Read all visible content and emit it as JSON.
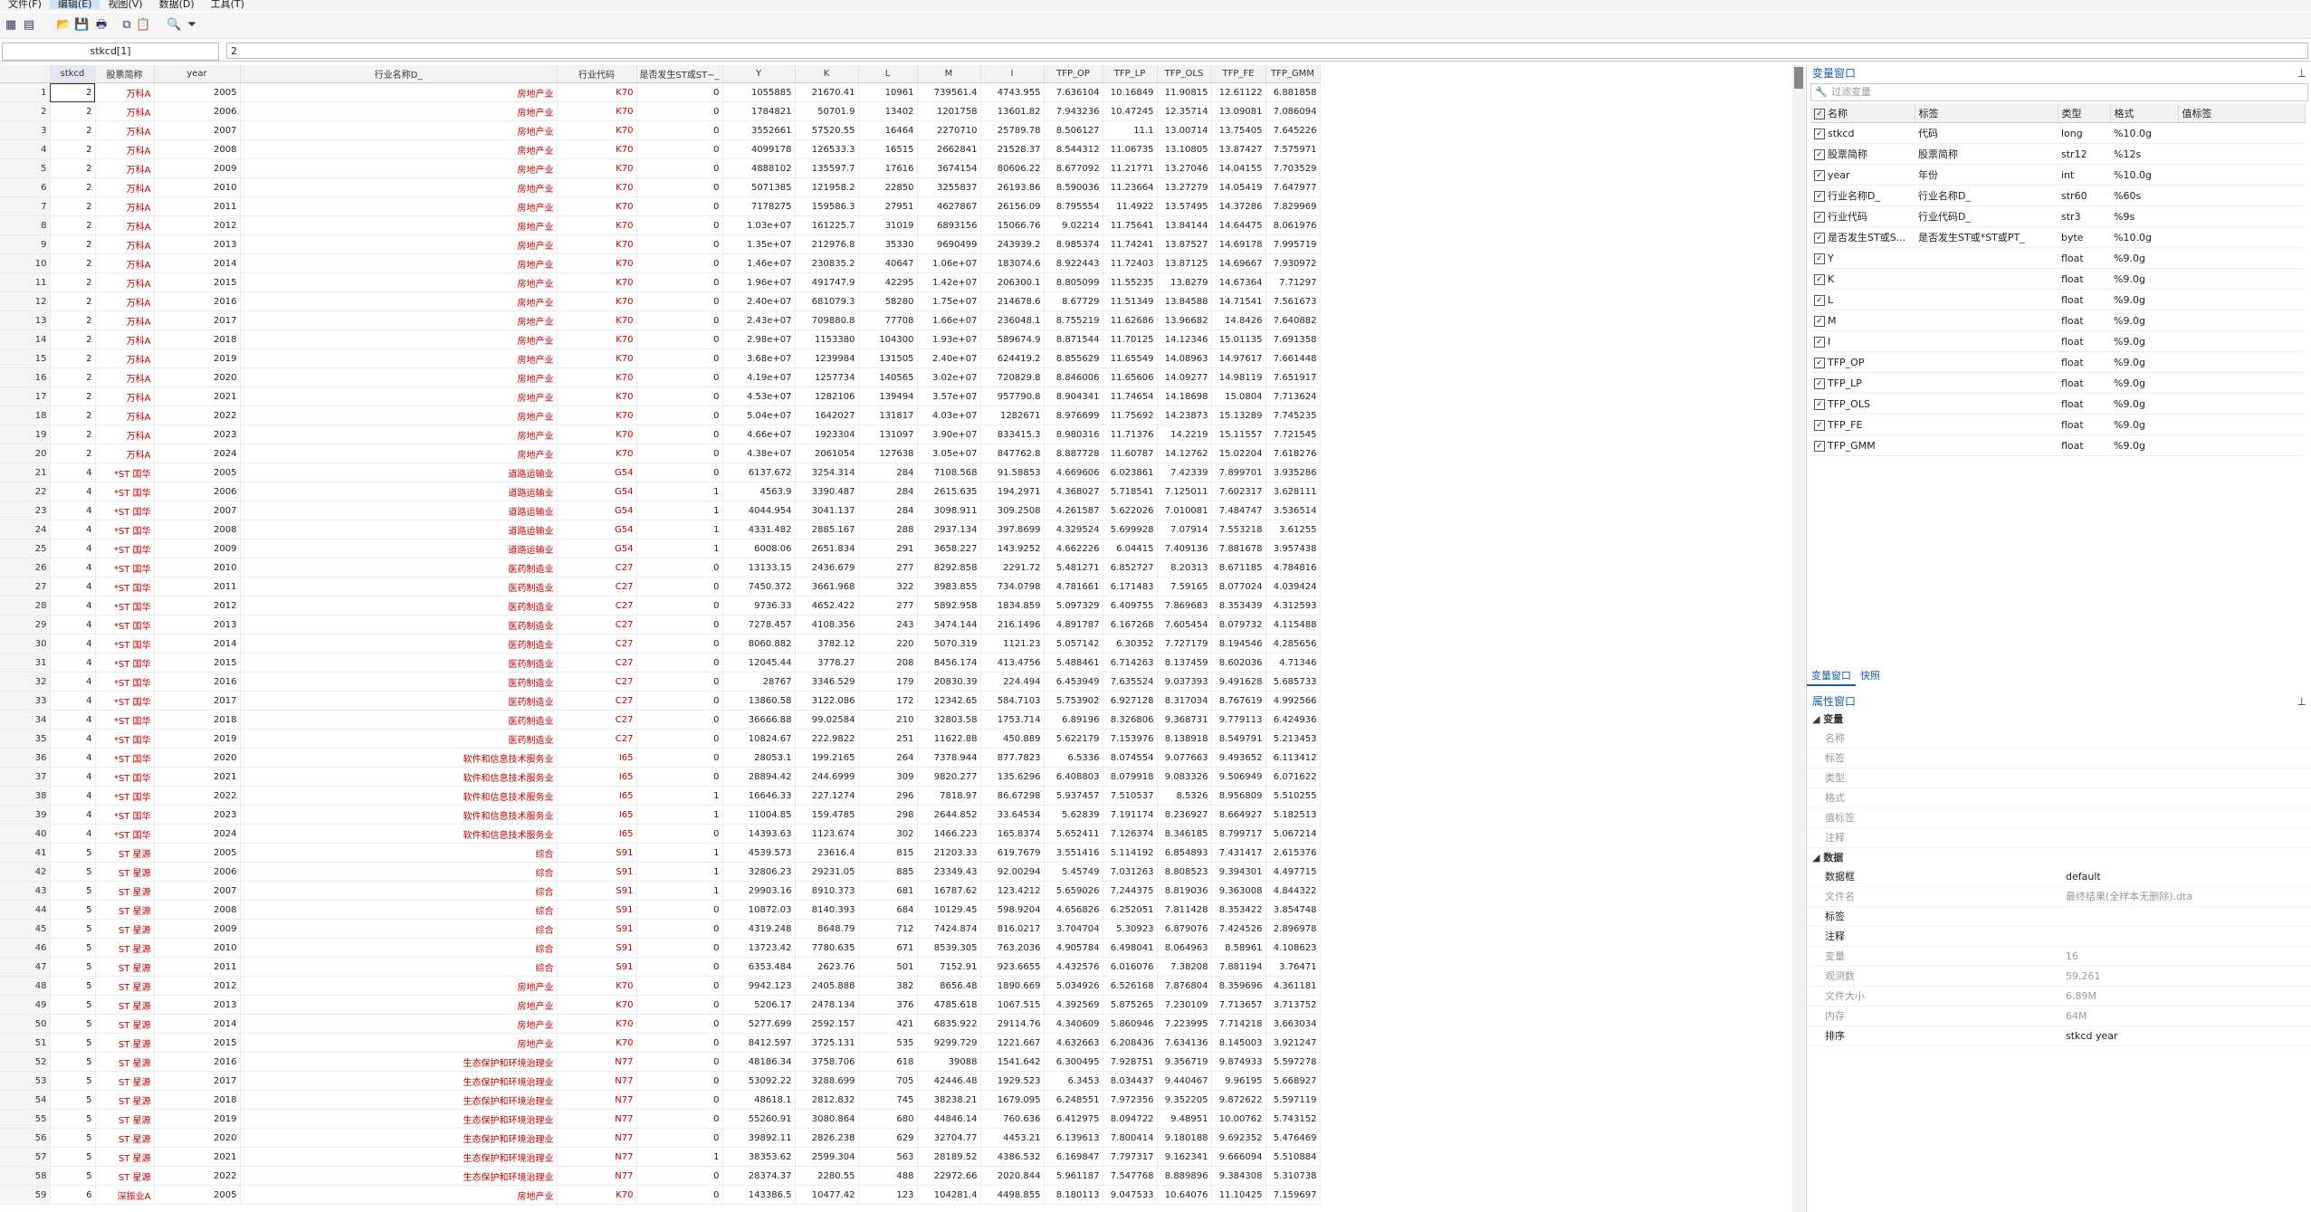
{
  "menu": [
    "文件(F)",
    "编辑(E)",
    "视图(V)",
    "数据(D)",
    "工具(T)"
  ],
  "toolbar_icons": [
    "browse-icon",
    "editor-icon",
    "open-icon",
    "save-icon",
    "print-icon",
    "copy-icon",
    "paste-icon",
    "find-icon",
    "filter-icon"
  ],
  "edit_bar": {
    "varname": "stkcd[1]",
    "value": "2"
  },
  "columns": [
    "stkcd",
    "股票简称",
    "year",
    "行业名称D_",
    "行业代码",
    "是否发生ST或ST~_",
    "Y",
    "K",
    "L",
    "M",
    "I",
    "TFP_OP",
    "TFP_LP",
    "TFP_OLS",
    "TFP_FE",
    "TFP_GMM"
  ],
  "rows": [
    [
      "2",
      "万科A",
      "2005",
      "房地产业",
      "K70",
      "0",
      "1055885",
      "21670.41",
      "10961",
      "739561.4",
      "4743.955",
      "7.636104",
      "10.16849",
      "11.90815",
      "12.61122",
      "6.881858"
    ],
    [
      "2",
      "万科A",
      "2006",
      "房地产业",
      "K70",
      "0",
      "1784821",
      "50701.9",
      "13402",
      "1201758",
      "13601.82",
      "7.943236",
      "10.47245",
      "12.35714",
      "13.09081",
      "7.086094"
    ],
    [
      "2",
      "万科A",
      "2007",
      "房地产业",
      "K70",
      "0",
      "3552661",
      "57520.55",
      "16464",
      "2270710",
      "25789.78",
      "8.506127",
      "11.1",
      "13.00714",
      "13.75405",
      "7.645226"
    ],
    [
      "2",
      "万科A",
      "2008",
      "房地产业",
      "K70",
      "0",
      "4099178",
      "126533.3",
      "16515",
      "2662841",
      "21528.37",
      "8.544312",
      "11.06735",
      "13.10805",
      "13.87427",
      "7.575971"
    ],
    [
      "2",
      "万科A",
      "2009",
      "房地产业",
      "K70",
      "0",
      "4888102",
      "135597.7",
      "17616",
      "3674154",
      "80606.22",
      "8.677092",
      "11.21771",
      "13.27046",
      "14.04155",
      "7.703529"
    ],
    [
      "2",
      "万科A",
      "2010",
      "房地产业",
      "K70",
      "0",
      "5071385",
      "121958.2",
      "22850",
      "3255837",
      "26193.86",
      "8.590036",
      "11.23664",
      "13.27279",
      "14.05419",
      "7.647977"
    ],
    [
      "2",
      "万科A",
      "2011",
      "房地产业",
      "K70",
      "0",
      "7178275",
      "159586.3",
      "27951",
      "4627867",
      "26156.09",
      "8.795554",
      "11.4922",
      "13.57495",
      "14.37286",
      "7.829969"
    ],
    [
      "2",
      "万科A",
      "2012",
      "房地产业",
      "K70",
      "0",
      "1.03e+07",
      "161225.7",
      "31019",
      "6893156",
      "15066.76",
      "9.02214",
      "11.75641",
      "13.84144",
      "14.64475",
      "8.061976"
    ],
    [
      "2",
      "万科A",
      "2013",
      "房地产业",
      "K70",
      "0",
      "1.35e+07",
      "212976.8",
      "35330",
      "9690499",
      "243939.2",
      "8.985374",
      "11.74241",
      "13.87527",
      "14.69178",
      "7.995719"
    ],
    [
      "2",
      "万科A",
      "2014",
      "房地产业",
      "K70",
      "0",
      "1.46e+07",
      "230835.2",
      "40647",
      "1.06e+07",
      "183074.6",
      "8.922443",
      "11.72403",
      "13.87125",
      "14.69667",
      "7.930972"
    ],
    [
      "2",
      "万科A",
      "2015",
      "房地产业",
      "K70",
      "0",
      "1.96e+07",
      "491747.9",
      "42295",
      "1.42e+07",
      "206300.1",
      "8.805099",
      "11.55235",
      "13.8279",
      "14.67364",
      "7.71297"
    ],
    [
      "2",
      "万科A",
      "2016",
      "房地产业",
      "K70",
      "0",
      "2.40e+07",
      "681079.3",
      "58280",
      "1.75e+07",
      "214678.6",
      "8.67729",
      "11.51349",
      "13.84588",
      "14.71541",
      "7.561673"
    ],
    [
      "2",
      "万科A",
      "2017",
      "房地产业",
      "K70",
      "0",
      "2.43e+07",
      "709880.8",
      "77708",
      "1.66e+07",
      "236048.1",
      "8.755219",
      "11.62686",
      "13.96682",
      "14.8426",
      "7.640882"
    ],
    [
      "2",
      "万科A",
      "2018",
      "房地产业",
      "K70",
      "0",
      "2.98e+07",
      "1153380",
      "104300",
      "1.93e+07",
      "589674.9",
      "8.871544",
      "11.70125",
      "14.12346",
      "15.01135",
      "7.691358"
    ],
    [
      "2",
      "万科A",
      "2019",
      "房地产业",
      "K70",
      "0",
      "3.68e+07",
      "1239984",
      "131505",
      "2.40e+07",
      "624419.2",
      "8.855629",
      "11.65549",
      "14.08963",
      "14.97617",
      "7.661448"
    ],
    [
      "2",
      "万科A",
      "2020",
      "房地产业",
      "K70",
      "0",
      "4.19e+07",
      "1257734",
      "140565",
      "3.02e+07",
      "720829.8",
      "8.846006",
      "11.65606",
      "14.09277",
      "14.98119",
      "7.651917"
    ],
    [
      "2",
      "万科A",
      "2021",
      "房地产业",
      "K70",
      "0",
      "4.53e+07",
      "1282106",
      "139494",
      "3.57e+07",
      "957790.8",
      "8.904341",
      "11.74654",
      "14.18698",
      "15.0804",
      "7.713624"
    ],
    [
      "2",
      "万科A",
      "2022",
      "房地产业",
      "K70",
      "0",
      "5.04e+07",
      "1642027",
      "131817",
      "4.03e+07",
      "1282671",
      "8.976699",
      "11.75692",
      "14.23873",
      "15.13289",
      "7.745235"
    ],
    [
      "2",
      "万科A",
      "2023",
      "房地产业",
      "K70",
      "0",
      "4.66e+07",
      "1923304",
      "131097",
      "3.90e+07",
      "833415.3",
      "8.980316",
      "11.71376",
      "14.2219",
      "15.11557",
      "7.721545"
    ],
    [
      "2",
      "万科A",
      "2024",
      "房地产业",
      "K70",
      "0",
      "4.38e+07",
      "2061054",
      "127638",
      "3.05e+07",
      "847762.8",
      "8.887728",
      "11.60787",
      "14.12762",
      "15.02204",
      "7.618276"
    ],
    [
      "4",
      "*ST 国华",
      "2005",
      "道路运输业",
      "G54",
      "0",
      "6137.672",
      "3254.314",
      "284",
      "7108.568",
      "91.58853",
      "4.669606",
      "6.023861",
      "7.42339",
      "7.899701",
      "3.935286"
    ],
    [
      "4",
      "*ST 国华",
      "2006",
      "道路运输业",
      "G54",
      "1",
      "4563.9",
      "3390.487",
      "284",
      "2615.635",
      "194.2971",
      "4.368027",
      "5.718541",
      "7.125011",
      "7.602317",
      "3.628111"
    ],
    [
      "4",
      "*ST 国华",
      "2007",
      "道路运输业",
      "G54",
      "1",
      "4044.954",
      "3041.137",
      "284",
      "3098.911",
      "309.2508",
      "4.261587",
      "5.622026",
      "7.010081",
      "7.484747",
      "3.536514"
    ],
    [
      "4",
      "*ST 国华",
      "2008",
      "道路运输业",
      "G54",
      "1",
      "4331.482",
      "2885.167",
      "288",
      "2937.134",
      "397.8699",
      "4.329524",
      "5.699928",
      "7.07914",
      "7.553218",
      "3.61255"
    ],
    [
      "4",
      "*ST 国华",
      "2009",
      "道路运输业",
      "G54",
      "1",
      "6008.06",
      "2651.834",
      "291",
      "3658.227",
      "143.9252",
      "4.662226",
      "6.04415",
      "7.409136",
      "7.881678",
      "3.957438"
    ],
    [
      "4",
      "*ST 国华",
      "2010",
      "医药制造业",
      "C27",
      "0",
      "13133.15",
      "2436.679",
      "277",
      "8292.858",
      "2291.72",
      "5.481271",
      "6.852727",
      "8.20313",
      "8.671185",
      "4.784816"
    ],
    [
      "4",
      "*ST 国华",
      "2011",
      "医药制造业",
      "C27",
      "0",
      "7450.372",
      "3661.968",
      "322",
      "3983.855",
      "734.0798",
      "4.781661",
      "6.171483",
      "7.59165",
      "8.077024",
      "4.039424"
    ],
    [
      "4",
      "*ST 国华",
      "2012",
      "医药制造业",
      "C27",
      "0",
      "9736.33",
      "4652.422",
      "277",
      "5892.958",
      "1834.859",
      "5.097329",
      "6.409755",
      "7.869683",
      "8.353439",
      "4.312593"
    ],
    [
      "4",
      "*ST 国华",
      "2013",
      "医药制造业",
      "C27",
      "0",
      "7278.457",
      "4108.356",
      "243",
      "3474.144",
      "216.1496",
      "4.891787",
      "6.167268",
      "7.605454",
      "8.079732",
      "4.115488"
    ],
    [
      "4",
      "*ST 国华",
      "2014",
      "医药制造业",
      "C27",
      "0",
      "8060.882",
      "3782.12",
      "220",
      "5070.319",
      "1121.23",
      "5.057142",
      "6.30352",
      "7.727179",
      "8.194546",
      "4.285656"
    ],
    [
      "4",
      "*ST 国华",
      "2015",
      "医药制造业",
      "C27",
      "0",
      "12045.44",
      "3778.27",
      "208",
      "8456.174",
      "413.4756",
      "5.488461",
      "6.714263",
      "8.137459",
      "8.602036",
      "4.71346"
    ],
    [
      "4",
      "*ST 国华",
      "2016",
      "医药制造业",
      "C27",
      "0",
      "28767",
      "3346.529",
      "179",
      "20830.39",
      "224.494",
      "6.453949",
      "7.635524",
      "9.037393",
      "9.491628",
      "5.685733"
    ],
    [
      "4",
      "*ST 国华",
      "2017",
      "医药制造业",
      "C27",
      "0",
      "13860.58",
      "3122.086",
      "172",
      "12342.65",
      "584.7103",
      "5.753902",
      "6.927128",
      "8.317034",
      "8.767619",
      "4.992566"
    ],
    [
      "4",
      "*ST 国华",
      "2018",
      "医药制造业",
      "C27",
      "0",
      "36666.88",
      "99.02584",
      "210",
      "32803.58",
      "1753.714",
      "6.89196",
      "8.326806",
      "9.368731",
      "9.779113",
      "6.424936"
    ],
    [
      "4",
      "*ST 国华",
      "2019",
      "医药制造业",
      "C27",
      "0",
      "10824.67",
      "222.9822",
      "251",
      "11622.88",
      "450.889",
      "5.622179",
      "7.153976",
      "8.138918",
      "8.549791",
      "5.213453"
    ],
    [
      "4",
      "*ST 国华",
      "2020",
      "软件和信息技术服务业",
      "I65",
      "0",
      "28053.1",
      "199.2165",
      "264",
      "7378.944",
      "877.7823",
      "6.5336",
      "8.074554",
      "9.077663",
      "9.493652",
      "6.113412"
    ],
    [
      "4",
      "*ST 国华",
      "2021",
      "软件和信息技术服务业",
      "I65",
      "0",
      "28894.42",
      "244.6999",
      "309",
      "9820.277",
      "135.6296",
      "6.408803",
      "8.079918",
      "9.083326",
      "9.506949",
      "6.071622"
    ],
    [
      "4",
      "*ST 国华",
      "2022",
      "软件和信息技术服务业",
      "I65",
      "1",
      "16646.33",
      "227.1274",
      "296",
      "7818.97",
      "86.67298",
      "5.937457",
      "7.510537",
      "8.5326",
      "8.956809",
      "5.510255"
    ],
    [
      "4",
      "*ST 国华",
      "2023",
      "软件和信息技术服务业",
      "I65",
      "1",
      "11004.85",
      "159.4785",
      "298",
      "2644.852",
      "33.64534",
      "5.62839",
      "7.191174",
      "8.236927",
      "8.664927",
      "5.182513"
    ],
    [
      "4",
      "*ST 国华",
      "2024",
      "软件和信息技术服务业",
      "I65",
      "0",
      "14393.63",
      "1123.674",
      "302",
      "1466.223",
      "165.8374",
      "5.652411",
      "7.126374",
      "8.346185",
      "8.799717",
      "5.067214"
    ],
    [
      "5",
      "ST 星源",
      "2005",
      "综合",
      "S91",
      "1",
      "4539.573",
      "23616.4",
      "815",
      "21203.33",
      "619.7679",
      "3.551416",
      "5.114192",
      "6.854893",
      "7.431417",
      "2.615376"
    ],
    [
      "5",
      "ST 星源",
      "2006",
      "综合",
      "S91",
      "1",
      "32806.23",
      "29231.05",
      "885",
      "23349.43",
      "92.00294",
      "5.45749",
      "7.031263",
      "8.808523",
      "9.394301",
      "4.497715"
    ],
    [
      "5",
      "ST 星源",
      "2007",
      "综合",
      "S91",
      "1",
      "29903.16",
      "8910.373",
      "681",
      "16787.62",
      "123.4212",
      "5.659026",
      "7.244375",
      "8.819036",
      "9.363008",
      "4.844322"
    ],
    [
      "5",
      "ST 星源",
      "2008",
      "综合",
      "S91",
      "0",
      "10872.03",
      "8140.393",
      "684",
      "10129.45",
      "598.9204",
      "4.656826",
      "6.252051",
      "7.811428",
      "8.353422",
      "3.854748"
    ],
    [
      "5",
      "ST 星源",
      "2009",
      "综合",
      "S91",
      "0",
      "4319.248",
      "8648.79",
      "712",
      "7424.874",
      "816.0217",
      "3.704704",
      "5.30923",
      "6.879076",
      "7.424526",
      "2.896978"
    ],
    [
      "5",
      "ST 星源",
      "2010",
      "综合",
      "S91",
      "0",
      "13723.42",
      "7780.635",
      "671",
      "8539.305",
      "763.2036",
      "4.905784",
      "6.498041",
      "8.064963",
      "8.58961",
      "4.108623"
    ],
    [
      "5",
      "ST 星源",
      "2011",
      "综合",
      "S91",
      "0",
      "6353.484",
      "2623.76",
      "501",
      "7152.91",
      "923.6655",
      "4.432576",
      "6.016076",
      "7.38208",
      "7.881194",
      "3.76471"
    ],
    [
      "5",
      "ST 星源",
      "2012",
      "房地产业",
      "K70",
      "0",
      "9942.123",
      "2405.888",
      "382",
      "8656.48",
      "1890.669",
      "5.034926",
      "6.526168",
      "7.876804",
      "8.359696",
      "4.361181"
    ],
    [
      "5",
      "ST 星源",
      "2013",
      "房地产业",
      "K70",
      "0",
      "5206.17",
      "2478.134",
      "376",
      "4785.618",
      "1067.515",
      "4.392569",
      "5.875265",
      "7.230109",
      "7.713657",
      "3.713752"
    ],
    [
      "5",
      "ST 星源",
      "2014",
      "房地产业",
      "K70",
      "0",
      "5277.699",
      "2592.157",
      "421",
      "6835.922",
      "29114.76",
      "4.340609",
      "5.860946",
      "7.223995",
      "7.714218",
      "3.663034"
    ],
    [
      "5",
      "ST 星源",
      "2015",
      "房地产业",
      "K70",
      "0",
      "8412.597",
      "3725.131",
      "535",
      "9299.729",
      "1221.667",
      "4.632663",
      "6.208436",
      "7.634136",
      "8.145003",
      "3.921247"
    ],
    [
      "5",
      "ST 星源",
      "2016",
      "生态保护和环境治理业",
      "N77",
      "0",
      "48186.34",
      "3758.706",
      "618",
      "39088",
      "1541.642",
      "6.300495",
      "7.928751",
      "9.356719",
      "9.874933",
      "5.597278"
    ],
    [
      "5",
      "ST 星源",
      "2017",
      "生态保护和环境治理业",
      "N77",
      "0",
      "53092.22",
      "3288.699",
      "705",
      "42446.48",
      "1929.523",
      "6.3453",
      "8.034437",
      "9.440467",
      "9.96195",
      "5.668927"
    ],
    [
      "5",
      "ST 星源",
      "2018",
      "生态保护和环境治理业",
      "N77",
      "0",
      "48618.1",
      "2812.832",
      "745",
      "38238.21",
      "1679.095",
      "6.248551",
      "7.972356",
      "9.352205",
      "9.872622",
      "5.597119"
    ],
    [
      "5",
      "ST 星源",
      "2019",
      "生态保护和环境治理业",
      "N77",
      "0",
      "55260.91",
      "3080.864",
      "680",
      "44846.14",
      "760.636",
      "6.412975",
      "8.094722",
      "9.48951",
      "10.00762",
      "5.743152"
    ],
    [
      "5",
      "ST 星源",
      "2020",
      "生态保护和环境治理业",
      "N77",
      "0",
      "39892.11",
      "2826.238",
      "629",
      "32704.77",
      "4453.21",
      "6.139613",
      "7.800414",
      "9.180188",
      "9.692352",
      "5.476469"
    ],
    [
      "5",
      "ST 星源",
      "2021",
      "生态保护和环境治理业",
      "N77",
      "1",
      "38353.62",
      "2599.304",
      "563",
      "28189.52",
      "4386.532",
      "6.169847",
      "7.797317",
      "9.162341",
      "9.666094",
      "5.510884"
    ],
    [
      "5",
      "ST 星源",
      "2022",
      "生态保护和环境治理业",
      "N77",
      "0",
      "28374.37",
      "2280.55",
      "488",
      "22972.66",
      "2020.844",
      "5.961187",
      "7.547768",
      "8.889896",
      "9.384308",
      "5.310738"
    ],
    [
      "6",
      "深振业A",
      "2005",
      "房地产业",
      "K70",
      "0",
      "143386.5",
      "10477.42",
      "123",
      "104281.4",
      "4498.855",
      "8.180113",
      "9.047533",
      "10.64076",
      "11.10425",
      "7.159697"
    ]
  ],
  "var_window": {
    "title": "变量窗口",
    "filter_placeholder": "过滤变量",
    "headers": [
      "名称",
      "标签",
      "类型",
      "格式",
      "值标签"
    ],
    "vars": [
      [
        "stkcd",
        "代码",
        "long",
        "%10.0g",
        ""
      ],
      [
        "股票简称",
        "股票简称",
        "str12",
        "%12s",
        ""
      ],
      [
        "year",
        "年份",
        "int",
        "%10.0g",
        ""
      ],
      [
        "行业名称D_",
        "行业名称D_",
        "str60",
        "%60s",
        ""
      ],
      [
        "行业代码",
        "行业代码D_",
        "str3",
        "%9s",
        ""
      ],
      [
        "是否发生ST或S...",
        "是否发生ST或*ST或PT_",
        "byte",
        "%10.0g",
        ""
      ],
      [
        "Y",
        "",
        "float",
        "%9.0g",
        ""
      ],
      [
        "K",
        "",
        "float",
        "%9.0g",
        ""
      ],
      [
        "L",
        "",
        "float",
        "%9.0g",
        ""
      ],
      [
        "M",
        "",
        "float",
        "%9.0g",
        ""
      ],
      [
        "I",
        "",
        "float",
        "%9.0g",
        ""
      ],
      [
        "TFP_OP",
        "",
        "float",
        "%9.0g",
        ""
      ],
      [
        "TFP_LP",
        "",
        "float",
        "%9.0g",
        ""
      ],
      [
        "TFP_OLS",
        "",
        "float",
        "%9.0g",
        ""
      ],
      [
        "TFP_FE",
        "",
        "float",
        "%9.0g",
        ""
      ],
      [
        "TFP_GMM",
        "",
        "float",
        "%9.0g",
        ""
      ]
    ]
  },
  "tabs": [
    "变量窗口",
    "快照"
  ],
  "properties": {
    "title": "属性窗口",
    "sec_var": "变量",
    "var_fields": [
      "名称",
      "标签",
      "类型",
      "格式",
      "值标签",
      "注释"
    ],
    "sec_data": "数据",
    "data_fields": [
      {
        "k": "数据框",
        "v": "default",
        "dark": true
      },
      {
        "k": "文件名",
        "v": "最终结果(全样本无删除).dta",
        "dark": false
      },
      {
        "k": "标签",
        "v": "",
        "dark": true
      },
      {
        "k": "注释",
        "v": "",
        "dark": true
      },
      {
        "k": "变量",
        "v": "16",
        "dark": false
      },
      {
        "k": "观测数",
        "v": "59,261",
        "dark": false
      },
      {
        "k": "文件大小",
        "v": "6.89M",
        "dark": false
      },
      {
        "k": "内存",
        "v": "64M",
        "dark": false
      },
      {
        "k": "排序",
        "v": "stkcd year",
        "dark": true
      }
    ]
  }
}
